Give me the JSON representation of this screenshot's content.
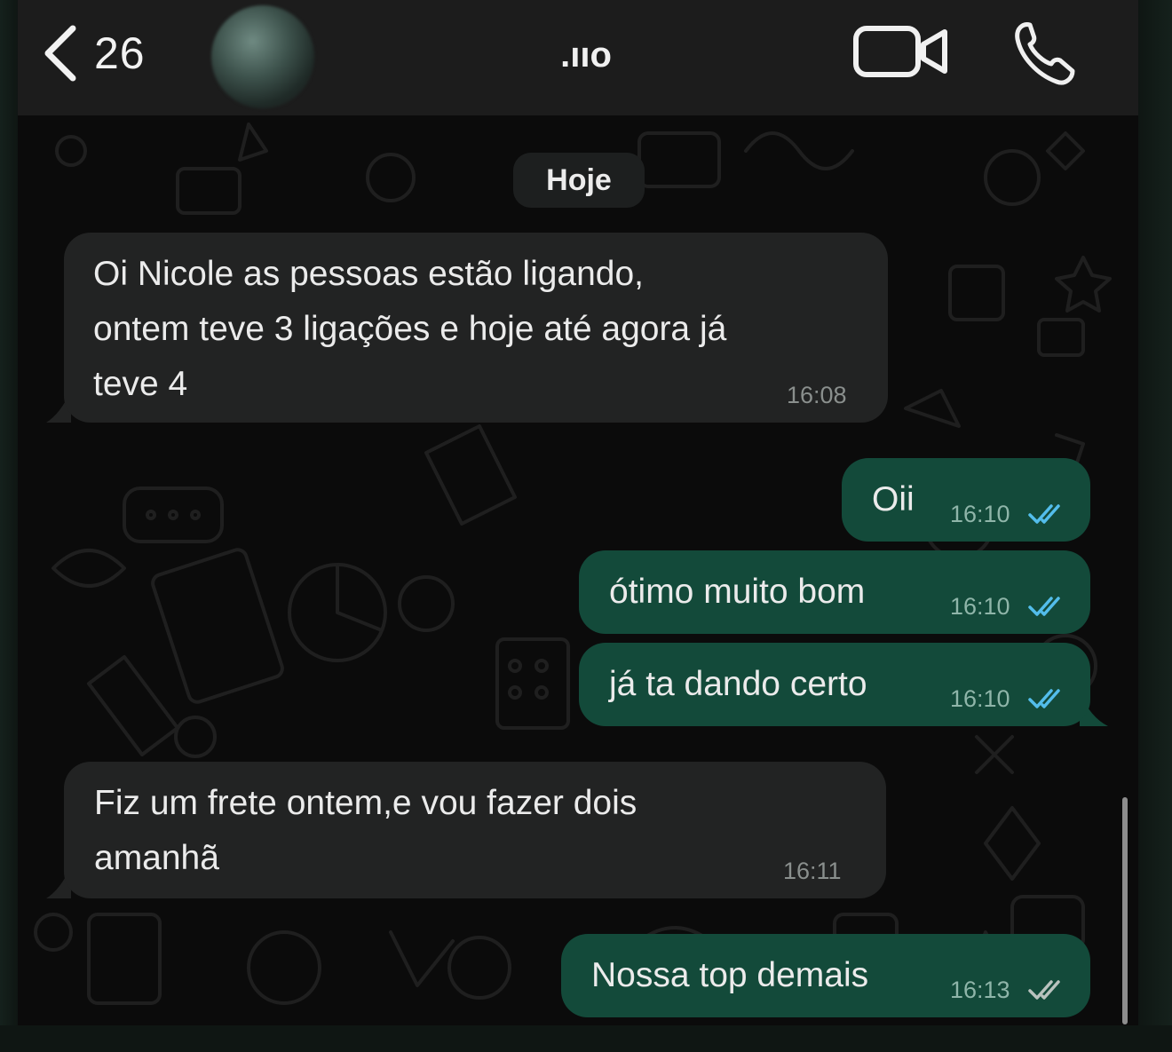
{
  "header": {
    "back_count": "26",
    "contact_name": ".ııo",
    "icons": {
      "back": "chevron-left-icon",
      "video": "video-camera-icon",
      "phone": "phone-icon"
    }
  },
  "chat": {
    "date_separator": "Hoje",
    "messages": [
      {
        "direction": "in",
        "text": "Oi Nicole as pessoas estão ligando,\nontem teve 3 ligações e hoje até agora já\nteve 4",
        "time": "16:08"
      },
      {
        "direction": "out",
        "text": "Oii",
        "time": "16:10",
        "status": "read"
      },
      {
        "direction": "out",
        "text": "ótimo muito bom",
        "time": "16:10",
        "status": "read"
      },
      {
        "direction": "out",
        "text": "já ta dando certo",
        "time": "16:10",
        "status": "read"
      },
      {
        "direction": "in",
        "text": "Fiz um frete ontem,e vou fazer dois\namanhã",
        "time": "16:11"
      },
      {
        "direction": "out",
        "text": "Nossa top demais",
        "time": "16:13",
        "status": "delivered"
      }
    ]
  },
  "colors": {
    "header_bg": "#1c1c1c",
    "chat_bg": "#0b0b0b",
    "incoming_bubble": "#222323",
    "outgoing_bubble": "#134a3a",
    "read_ticks": "#53bdeb",
    "delivered_ticks": "#b9c2be"
  }
}
